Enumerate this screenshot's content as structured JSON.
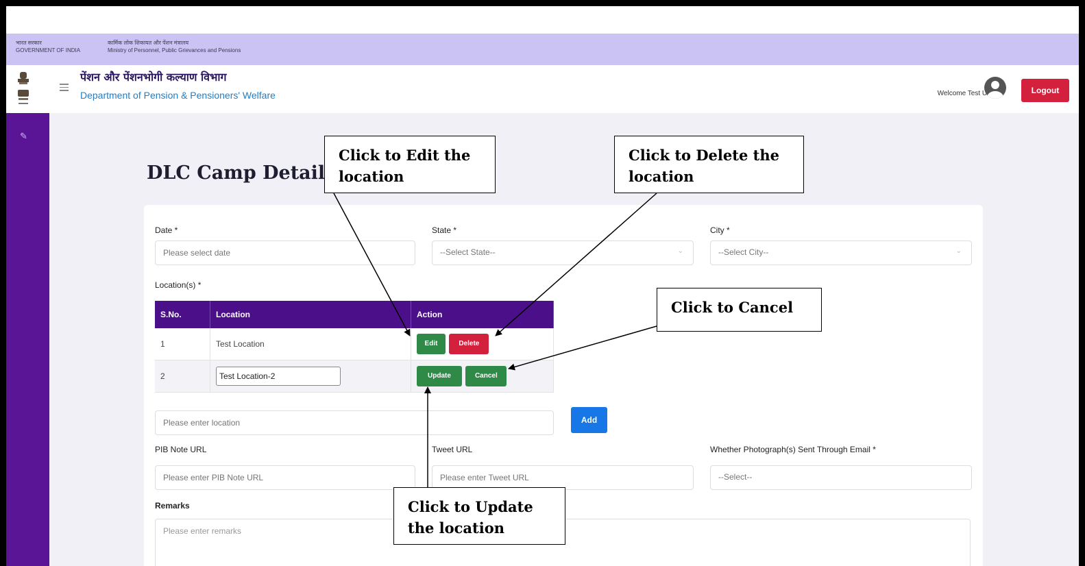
{
  "gov_bar": {
    "left_line1": "भारत सरकार",
    "left_line2": "GOVERNMENT OF INDIA",
    "right_line1": "कार्मिक लोक शिकायत और पेंशन मंत्रालय",
    "right_line2": "Ministry of Personnel, Public Grievances and Pensions"
  },
  "header": {
    "hindi_title": "पेंशन और पेंशनभोगी कल्याण विभाग",
    "dept_title": "Department of Pension & Pensioners' Welfare",
    "welcome": "Welcome Test User",
    "logout_label": "Logout"
  },
  "sidebar": {
    "icon": "edit-icon"
  },
  "page": {
    "title": "DLC Camp Detail"
  },
  "form": {
    "date_label": "Date *",
    "date_placeholder": "Please select date",
    "state_label": "State *",
    "state_value": "--Select State--",
    "city_label": "City *",
    "city_value": "--Select City--",
    "locations_label": "Location(s) *",
    "table_headers": [
      "S.No.",
      "Location",
      "Action"
    ],
    "rows": [
      {
        "sno": "1",
        "location": "Test Location",
        "btn1": "Edit",
        "btn2": "Delete"
      },
      {
        "sno": "2",
        "location": "Test Location-2",
        "btn1": "Update",
        "btn2": "Cancel"
      }
    ],
    "location_placeholder": "Please enter location",
    "add_label": "Add",
    "pib_label": "PIB Note URL",
    "pib_placeholder": "Please enter PIB Note URL",
    "tweet_label": "Tweet URL",
    "tweet_placeholder": "Please enter Tweet URL",
    "photo_label": "Whether Photograph(s) Sent Through Email *",
    "photo_value": "--Select--",
    "remarks_label": "Remarks",
    "remarks_placeholder": "Please enter remarks"
  },
  "callouts": {
    "edit": "Click to Edit the location",
    "delete": "Click to Delete the location",
    "cancel": "Click to Cancel",
    "update": "Click to Update the location"
  }
}
